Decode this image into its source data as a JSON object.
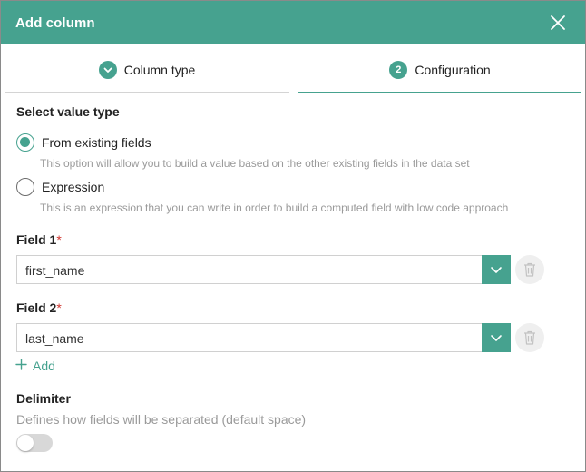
{
  "dialog": {
    "title": "Add column",
    "close_icon": "close-icon"
  },
  "steps": [
    {
      "label": "Column type",
      "status": "done",
      "icon": "check-icon"
    },
    {
      "label": "Configuration",
      "status": "active",
      "number": "2"
    }
  ],
  "value_type": {
    "title": "Select value type",
    "options": [
      {
        "label": "From existing fields",
        "help": "This option will allow you to build a value based on the other existing fields in the data set",
        "checked": true
      },
      {
        "label": "Expression",
        "help": "This is an expression that you can write in order to build a computed field with low code approach",
        "checked": false
      }
    ]
  },
  "fields": [
    {
      "label": "Field 1",
      "required_mark": "*",
      "value": "first_name"
    },
    {
      "label": "Field 2",
      "required_mark": "*",
      "value": "last_name"
    }
  ],
  "add_label": "Add",
  "delimiter": {
    "title": "Delimiter",
    "help": "Defines how fields will be separated (default space)",
    "enabled": false
  },
  "colors": {
    "accent": "#46a28f",
    "required": "#d0352f",
    "muted_text": "#9a9a9a"
  }
}
